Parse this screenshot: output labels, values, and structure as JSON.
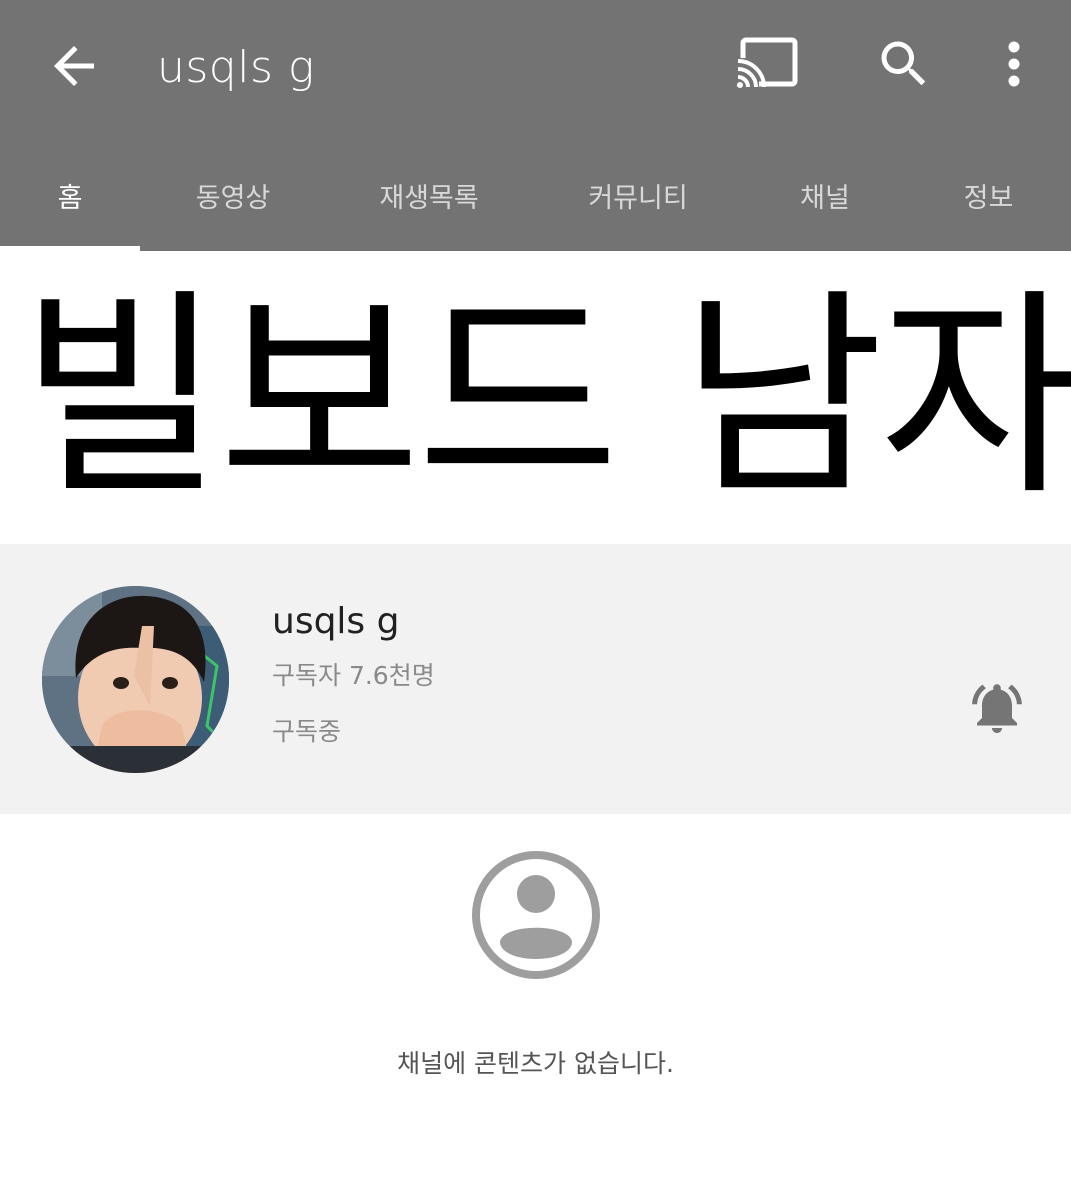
{
  "appbar": {
    "title": "usqls g",
    "back_icon": "arrow-back-icon",
    "cast_icon": "cast-icon",
    "search_icon": "search-icon",
    "more_icon": "more-vert-icon",
    "background": "#737373"
  },
  "tabs": [
    {
      "label": "홈",
      "active": true
    },
    {
      "label": "동영상",
      "active": false
    },
    {
      "label": "재생목록",
      "active": false
    },
    {
      "label": "커뮤니티",
      "active": false
    },
    {
      "label": "채널",
      "active": false
    },
    {
      "label": "정보",
      "active": false
    }
  ],
  "banner": {
    "text": "빌보드 남자"
  },
  "channel": {
    "name": "usqls g",
    "subscribers": "구독자 7.6천명",
    "status": "구독중",
    "bell_icon": "notifications-active-icon"
  },
  "empty_state": {
    "icon": "account-circle-icon",
    "message": "채널에 콘텐츠가 없습니다."
  }
}
